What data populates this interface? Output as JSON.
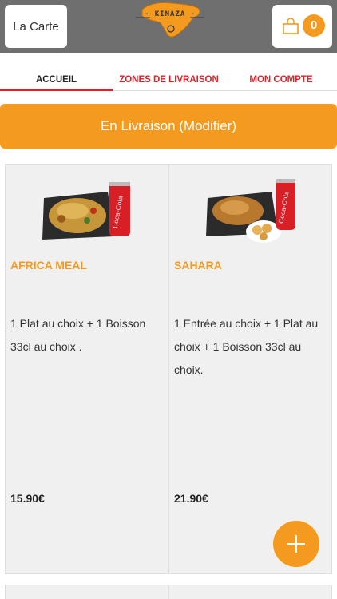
{
  "header": {
    "menu_label": "La Carte",
    "logo_text": "- KINAZA -",
    "cart_count": "0"
  },
  "tabs": [
    {
      "label": "ACCUEIL",
      "active": true
    },
    {
      "label": "ZONES DE LIVRAISON",
      "active": false
    },
    {
      "label": "MON COMPTE",
      "active": false
    }
  ],
  "delivery_mode_label": "En Livraison (Modifier)",
  "products": [
    {
      "name": "AFRICA MEAL",
      "description": "1 Plat au choix + 1 Boisson 33cl au choix .",
      "price": "15.90€"
    },
    {
      "name": "SAHARA",
      "description": "1 Entrée au choix + 1 Plat au choix + 1 Boisson 33cl au choix.",
      "price": "21.90€"
    }
  ],
  "colors": {
    "accent": "#f39a1f",
    "tab_red": "#d9232b",
    "header_bg": "#6f6f6f"
  }
}
